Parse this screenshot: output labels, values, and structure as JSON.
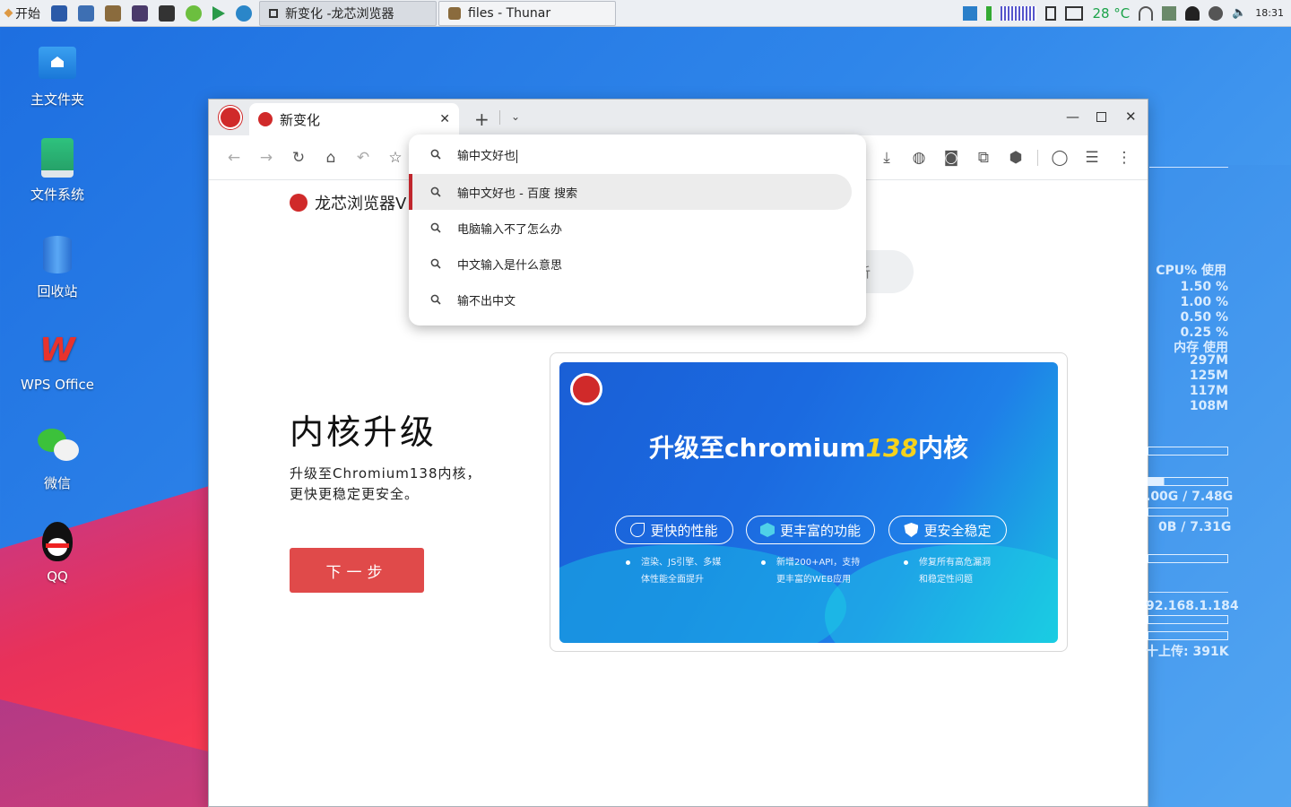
{
  "taskbar": {
    "start_label": "开始",
    "tasks": [
      {
        "label": "新变化 -龙芯浏览器",
        "active": true
      },
      {
        "label": "files - Thunar",
        "active": false
      }
    ],
    "temperature": "28 °C",
    "clock": "18:31",
    "icons": [
      "terminal-icon",
      "screenshot-icon",
      "paint-icon",
      "monitor-icon",
      "display-icon",
      "chrome-icon",
      "media-play-icon",
      "browser-icon"
    ]
  },
  "desktop": {
    "icons": [
      {
        "label": "主文件夹",
        "icon": "home-folder-icon"
      },
      {
        "label": "文件系统",
        "icon": "drive-icon"
      },
      {
        "label": "回收站",
        "icon": "trash-icon"
      },
      {
        "label": "WPS Office",
        "icon": "wps-icon"
      },
      {
        "label": "微信",
        "icon": "wechat-icon"
      },
      {
        "label": "QQ",
        "icon": "qq-icon"
      }
    ]
  },
  "browser": {
    "tab_title": "新变化",
    "omnibox": {
      "input": "输中文好也",
      "suggestions": [
        {
          "text": "输中文好也 - 百度 搜索",
          "selected": true
        },
        {
          "text": "电脑输入不了怎么办",
          "selected": false
        },
        {
          "text": "中文输入是什么意思",
          "selected": false
        },
        {
          "text": "输不出中文",
          "selected": false
        }
      ]
    },
    "page": {
      "brand": "龙芯浏览器V",
      "search_fragment": "析",
      "heading": "内核升级",
      "description_line1": "升级至Chromium138内核，",
      "description_line2": "更快更稳定更安全。",
      "next_button": "下一步",
      "banner": {
        "title_prefix": "升级至chromium",
        "title_number": "138",
        "title_suffix": "内核",
        "features": [
          {
            "label": "更快的性能",
            "icon": "rocket-icon",
            "desc1": "渲染、JS引擎、多媒",
            "desc2": "体性能全面提升"
          },
          {
            "label": "更丰富的功能",
            "icon": "cube-icon",
            "desc1": "新增200+API，支持",
            "desc2": "更丰富的WEB应用"
          },
          {
            "label": "更安全稳定",
            "icon": "shield-icon",
            "desc1": "修复所有高危漏洞",
            "desc2": "和稳定性问题"
          }
        ]
      }
    }
  },
  "conky": {
    "cpu_header": "CPU% 使用",
    "cpu_values": [
      "1.50 %",
      "1.00 %",
      "0.50 %",
      "0.25 %"
    ],
    "mem_header": "内存  使用",
    "mem_values": [
      "297M",
      "125M",
      "117M",
      "108M"
    ],
    "disk1": ".00G / 7.48G",
    "disk2": "0B / 7.31G",
    "ip": "92.168.1.184",
    "upload": "十上传: 391K"
  },
  "colors": {
    "accent_red": "#d02a2a",
    "button_red": "#e04a4a",
    "banner_blue": "#1b6ae0",
    "temp_green": "#1ca34a"
  }
}
